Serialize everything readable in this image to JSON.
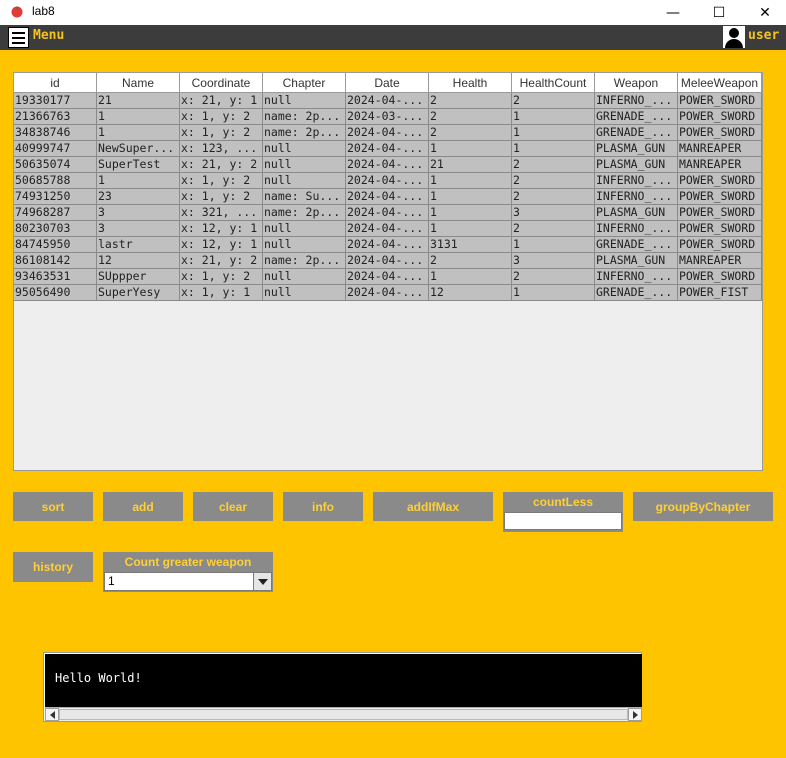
{
  "window": {
    "title": "lab8",
    "minimize": "—",
    "maximize": "☐",
    "close": "✕"
  },
  "menubar": {
    "menu_label": "Menu",
    "user_label": "user"
  },
  "colors": {
    "background": "#ffc400",
    "menubar": "#3c3c3c",
    "accent_text": "#f7c21d",
    "button": "#8a8a8a",
    "row": "#c0c0c0"
  },
  "table": {
    "columns": [
      "id",
      "Name",
      "Coordinate",
      "Chapter",
      "Date",
      "Health",
      "HealthCount",
      "Weapon",
      "MeleeWeapon"
    ],
    "rows": [
      [
        "19330177",
        "21",
        "x: 21, y: 1",
        "null",
        "2024-04-...",
        "2",
        "2",
        "INFERNO_...",
        "POWER_SWORD"
      ],
      [
        "21366763",
        "1",
        "x: 1, y: 2",
        "name: 2p...",
        "2024-03-...",
        "2",
        "1",
        "GRENADE_...",
        "POWER_SWORD"
      ],
      [
        "34838746",
        "1",
        "x: 1, y: 2",
        "name: 2p...",
        "2024-04-...",
        "2",
        "1",
        "GRENADE_...",
        "POWER_SWORD"
      ],
      [
        "40999747",
        "NewSuper...",
        "x: 123, ...",
        "null",
        "2024-04-...",
        "1",
        "1",
        "PLASMA_GUN",
        "MANREAPER"
      ],
      [
        "50635074",
        "SuperTest",
        "x: 21, y: 2",
        "null",
        "2024-04-...",
        "21",
        "2",
        "PLASMA_GUN",
        "MANREAPER"
      ],
      [
        "50685788",
        "1",
        "x: 1, y: 2",
        "null",
        "2024-04-...",
        "1",
        "2",
        "INFERNO_...",
        "POWER_SWORD"
      ],
      [
        "74931250",
        "23",
        "x: 1, y: 2",
        "name: Su...",
        "2024-04-...",
        "1",
        "2",
        "INFERNO_...",
        "POWER_SWORD"
      ],
      [
        "74968287",
        "3",
        "x: 321, ...",
        "name: 2p...",
        "2024-04-...",
        "1",
        "3",
        "PLASMA_GUN",
        "POWER_SWORD"
      ],
      [
        "80230703",
        "3",
        "x: 12, y: 1",
        "null",
        "2024-04-...",
        "1",
        "2",
        "INFERNO_...",
        "POWER_SWORD"
      ],
      [
        "84745950",
        "lastr",
        "x: 12, y: 1",
        "null",
        "2024-04-...",
        "3131",
        "1",
        "GRENADE_...",
        "POWER_SWORD"
      ],
      [
        "86108142",
        "12",
        "x: 21, y: 2",
        "name: 2p...",
        "2024-04-...",
        "2",
        "3",
        "PLASMA_GUN",
        "MANREAPER"
      ],
      [
        "93463531",
        "SUppper",
        "x: 1, y: 2",
        "null",
        "2024-04-...",
        "1",
        "2",
        "INFERNO_...",
        "POWER_SWORD"
      ],
      [
        "95056490",
        "SuperYesy",
        "x: 1, y: 1",
        "null",
        "2024-04-...",
        "12",
        "1",
        "GRENADE_...",
        "POWER_FIST"
      ]
    ]
  },
  "buttons": {
    "sort": "sort",
    "add": "add",
    "clear": "clear",
    "info": "info",
    "add_if_max": "addIfMax",
    "count_less": "countLess",
    "group_by_chapter": "groupByChapter",
    "history": "history"
  },
  "count_less": {
    "value": ""
  },
  "count_greater_weapon": {
    "label": "Count greater weapon",
    "selected": "1"
  },
  "console": {
    "text": "Hello World!"
  }
}
